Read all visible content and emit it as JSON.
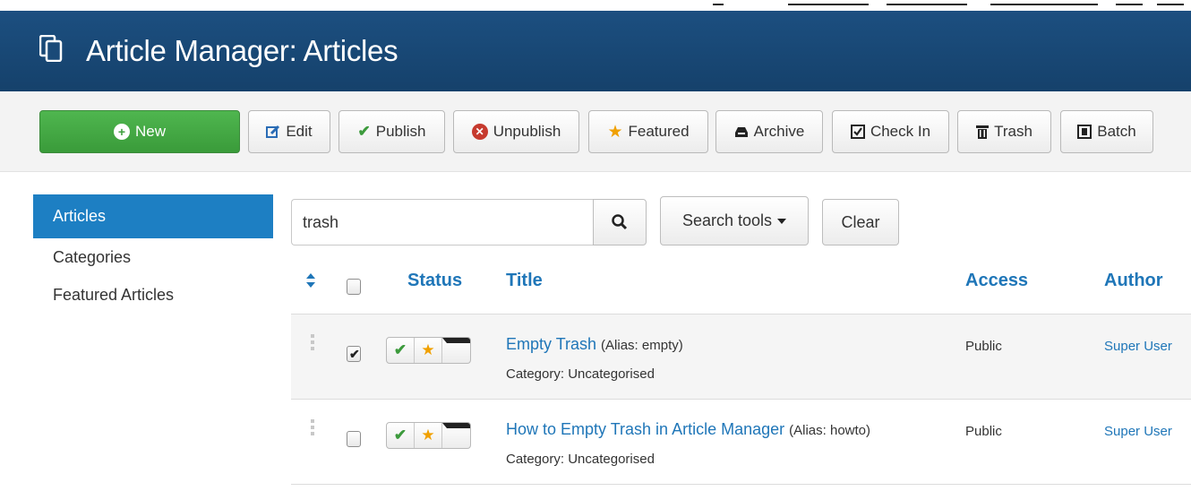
{
  "header": {
    "title": "Article Manager: Articles"
  },
  "toolbar": {
    "new": "New",
    "edit": "Edit",
    "publish": "Publish",
    "unpublish": "Unpublish",
    "featured": "Featured",
    "archive": "Archive",
    "checkin": "Check In",
    "trash": "Trash",
    "batch": "Batch"
  },
  "sidebar": {
    "items": [
      {
        "label": "Articles",
        "active": true
      },
      {
        "label": "Categories",
        "active": false
      },
      {
        "label": "Featured Articles",
        "active": false
      }
    ]
  },
  "filter": {
    "search_value": "trash",
    "tools_label": "Search tools",
    "clear_label": "Clear"
  },
  "table": {
    "columns": {
      "status": "Status",
      "title": "Title",
      "access": "Access",
      "author": "Author"
    },
    "rows": [
      {
        "checked": true,
        "title": "Empty Trash",
        "alias": "(Alias: empty)",
        "category": "Category: Uncategorised",
        "access": "Public",
        "author": "Super User"
      },
      {
        "checked": false,
        "title": "How to Empty Trash in Article Manager",
        "alias": "(Alias: howto)",
        "category": "Category: Uncategorised",
        "access": "Public",
        "author": "Super User"
      }
    ]
  },
  "colors": {
    "header": "#1c4f80",
    "accent": "#1f76b8",
    "new_button": "#46ad46",
    "active_nav": "#1d7fc3",
    "published": "#3c9a3c",
    "featured": "#f0a000",
    "unpublish": "#c63a2e"
  },
  "icons": [
    "joomla-articles-icon",
    "plus-circle-icon",
    "edit-icon",
    "checkmark-icon",
    "cross-circle-icon",
    "star-icon",
    "archive-icon",
    "checkbox-icon",
    "trash-icon",
    "batch-icon",
    "search-icon",
    "sort-icon",
    "drag-handle-icon",
    "caret-down-icon"
  ]
}
